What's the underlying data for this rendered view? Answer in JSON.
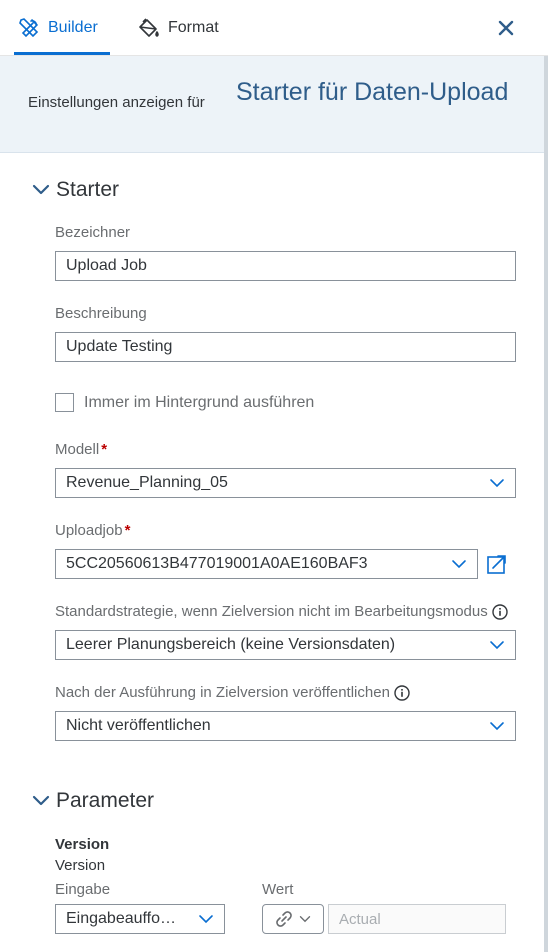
{
  "tabs": {
    "builder": "Builder",
    "format": "Format"
  },
  "header": {
    "label": "Einstellungen anzeigen für",
    "title": "Starter für Daten-Upload"
  },
  "starter": {
    "title": "Starter",
    "bezeichner_label": "Bezeichner",
    "bezeichner_value": "Upload Job",
    "beschreibung_label": "Beschreibung",
    "beschreibung_value": "Update Testing",
    "checkbox_label": "Immer im Hintergrund ausführen",
    "modell_label": "Modell",
    "modell_value": "Revenue_Planning_05",
    "uploadjob_label": "Uploadjob",
    "uploadjob_value": "5CC20560613B477019001A0AE160BAF3",
    "strategie_label": "Standardstrategie, wenn Zielversion nicht im Bearbeitungsmodus",
    "strategie_value": "Leerer Planungsbereich (keine Versionsdaten)",
    "publish_label": "Nach der Ausführung in Zielversion veröffentlichen",
    "publish_value": "Nicht veröffentlichen",
    "required_mark": "*"
  },
  "parameter": {
    "title": "Parameter",
    "version_title": "Version",
    "version_sub": "Version",
    "eingabe_label": "Eingabe",
    "wert_label": "Wert",
    "eingabe_value": "Eingabeauffo…",
    "wert_placeholder": "Actual"
  },
  "colors": {
    "accent": "#0a6ed1",
    "header_bg": "#edf3f8",
    "title": "#2f5d8a",
    "required": "#bb0000"
  },
  "icons": {
    "builder": "tools-icon",
    "format": "paint-bucket-icon",
    "close": "close-icon",
    "chevron": "chevron-down-icon",
    "info": "info-icon",
    "open": "open-in-new-icon",
    "link": "link-icon"
  }
}
